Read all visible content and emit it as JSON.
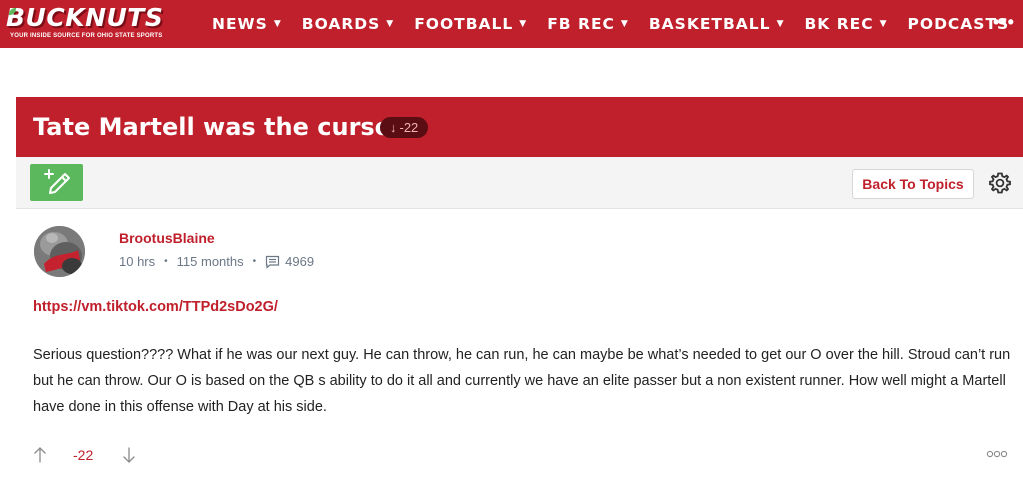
{
  "site": {
    "logo_text": "BUCKNUTS",
    "logo_tagline": "YOUR INSIDE SOURCE FOR OHIO STATE SPORTS"
  },
  "nav": {
    "items": [
      {
        "label": "NEWS",
        "has_dropdown": true
      },
      {
        "label": "BOARDS",
        "has_dropdown": true
      },
      {
        "label": "FOOTBALL",
        "has_dropdown": true
      },
      {
        "label": "FB REC",
        "has_dropdown": true
      },
      {
        "label": "BASKETBALL",
        "has_dropdown": true
      },
      {
        "label": "BK REC",
        "has_dropdown": true
      },
      {
        "label": "PODCASTS",
        "has_dropdown": false
      }
    ],
    "more_label": "•••"
  },
  "topic": {
    "title": "Tate Martell was the curse",
    "vote_arrow": "↓",
    "vote_score": "-22"
  },
  "toolbar": {
    "compose_icon": "new-post-icon",
    "back_label": "Back To Topics",
    "settings_icon": "gear-icon"
  },
  "post": {
    "author": "BrootusBlaine",
    "time_ago": "10 hrs",
    "membership": "115 months",
    "post_count": "4969",
    "link": "https://vm.tiktok.com/TTPd2sDo2G/",
    "body": "Serious question???? What if he was our next guy. He can throw, he can run, he can maybe be what’s needed to get our O over the hill. Stroud can’t run but he can throw. Our O is based on the QB s ability to do it all and currently we have an elite passer but a non existent runner. How well might a Martell have done in this offense with Day at his side.",
    "score": "-22"
  },
  "colors": {
    "brand_red": "#c0202c",
    "compose_green": "#5cb85c",
    "meta_gray": "#6b7785"
  }
}
